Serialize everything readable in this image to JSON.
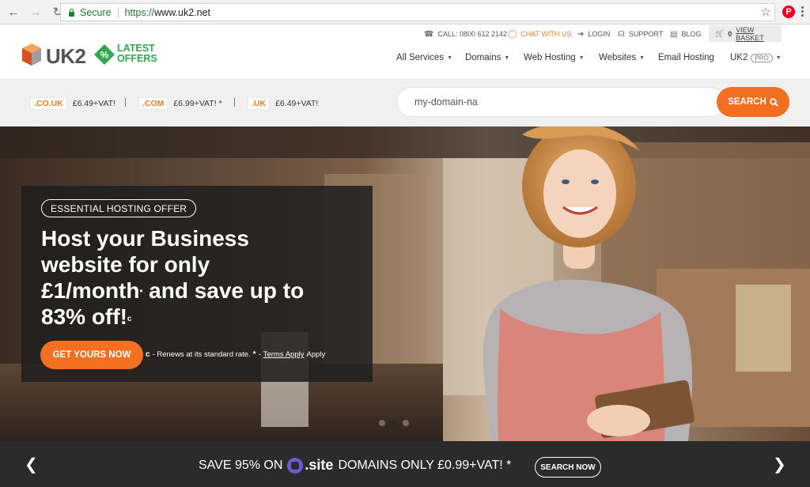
{
  "browser": {
    "secure_label": "Secure",
    "url_scheme": "https://",
    "url_host": "www.uk2.net",
    "pin_label": "P"
  },
  "header": {
    "logo_text": "UK2",
    "offers_line1": "LATEST",
    "offers_line2": "OFFERS",
    "offers_badge": "%",
    "utility": {
      "call": "CALL: 0800 612 2142",
      "chat": "CHAT WITH US",
      "login": "LOGIN",
      "support": "SUPPORT",
      "blog": "BLOG",
      "basket_count": "0",
      "basket_label": "VIEW BASKET"
    },
    "nav": {
      "all_services": "All Services",
      "domains": "Domains",
      "web_hosting": "Web Hosting",
      "websites": "Websites",
      "email_hosting": "Email Hosting",
      "uk2": "UK2",
      "pro_badge": "PRO"
    }
  },
  "domain_strip": {
    "tlds": [
      {
        "tag": ".CO.UK",
        "price": "£6.49+VAT!"
      },
      {
        "tag": ".COM",
        "price": "£6.99+VAT! *"
      },
      {
        "tag": ".UK",
        "price": "£6.49+VAT!"
      }
    ],
    "search_value": "my-domain-na",
    "search_button": "SEARCH"
  },
  "hero": {
    "badge": "ESSENTIAL HOSTING OFFER",
    "headline_line1": "Host your Business",
    "headline_line2": "website for only",
    "headline_line3a": "£1/month",
    "headline_sup1": "*",
    "headline_line3b": " and save up to",
    "headline_line4": "83% off!",
    "headline_sup2": "c",
    "cta_label": "GET YOURS NOW",
    "note_c": "c",
    "note_text": "- Renews at its standard rate.",
    "note_star": "*",
    "note_dash": "-",
    "note_terms": "Terms Apply",
    "note_apply": "Apply",
    "slide_count": 3,
    "active_slide": 1
  },
  "banner": {
    "text_prefix": "SAVE 95% ON",
    "site_logo": ".site",
    "text_suffix": "DOMAINS ONLY £0.99+VAT! *",
    "button": "SEARCH NOW"
  },
  "colors": {
    "brand_orange": "#f36f21",
    "offers_green": "#2fa84f",
    "banner_bg": "#2b2b2b"
  }
}
